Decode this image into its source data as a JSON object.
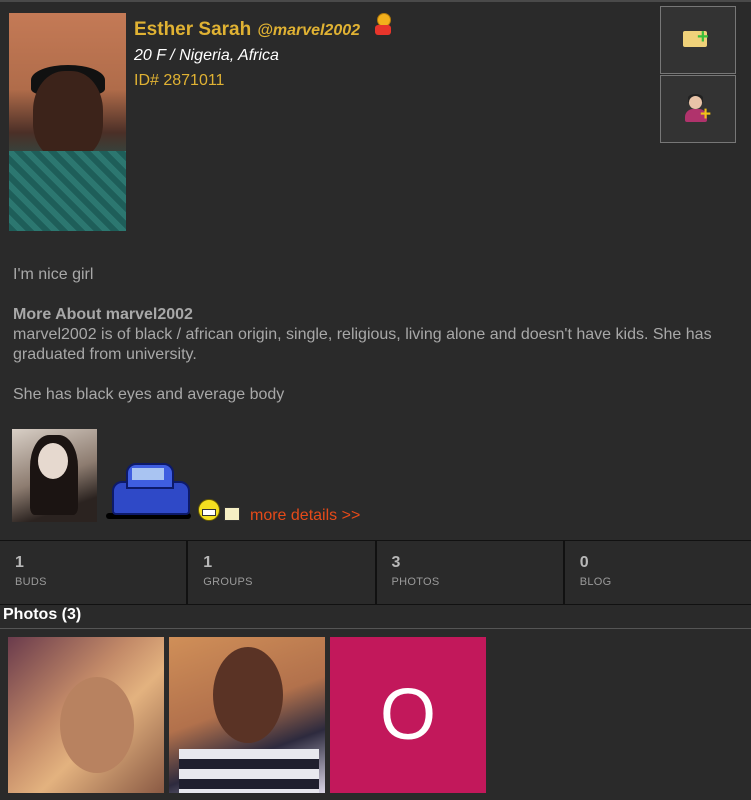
{
  "profile": {
    "name": "Esther Sarah",
    "handle": "@marvel2002",
    "age_location": "20 F / Nigeria, Africa",
    "id": "ID# 2871011"
  },
  "actions": {
    "message_icon": "message-add-icon",
    "friend_icon": "add-friend-icon"
  },
  "bio": {
    "intro": "I'm nice girl",
    "more_heading": "More About marvel2002",
    "more_text": "marvel2002 is of black / african origin, single, religious, living alone and doesn't have kids. She has graduated from university.",
    "appearance": "She has black eyes and average body"
  },
  "more_details_link": "more details >>",
  "stats": [
    {
      "value": "1",
      "label": "BUDS"
    },
    {
      "value": "1",
      "label": "GROUPS"
    },
    {
      "value": "3",
      "label": "PHOTOS"
    },
    {
      "value": "0",
      "label": "BLOG"
    }
  ],
  "photos": {
    "title": "Photos (3)",
    "tiles": [
      {
        "kind": "photo"
      },
      {
        "kind": "photo"
      },
      {
        "kind": "letter",
        "letter": "O",
        "color": "#c2185b"
      }
    ]
  },
  "colors": {
    "background": "#2a2a2a",
    "accent_gold": "#e0b233",
    "link_orange": "#e64a19"
  }
}
